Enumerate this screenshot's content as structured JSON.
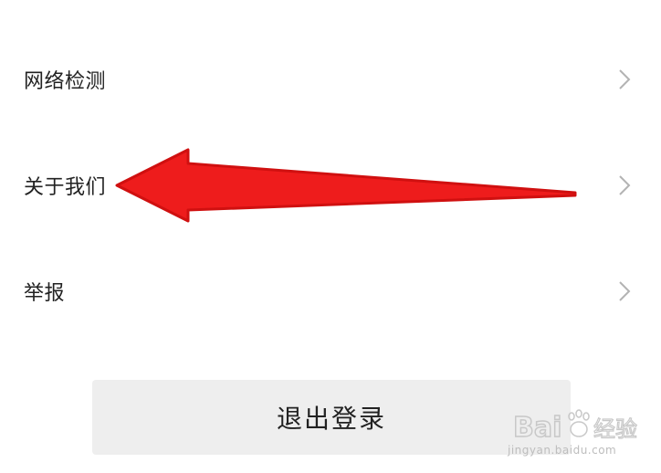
{
  "menu": {
    "items": [
      {
        "label": "网络检测",
        "icon": "chevron-right-icon"
      },
      {
        "label": "关于我们",
        "icon": "chevron-right-icon"
      },
      {
        "label": "举报",
        "icon": "chevron-right-icon"
      }
    ]
  },
  "logout": {
    "label": "退出登录"
  },
  "annotation": {
    "icon": "arrow-left-icon",
    "color": "#ee1c1c"
  },
  "watermark": {
    "logo_text": "Baidu经验",
    "url": "jingyan.baidu.com"
  },
  "colors": {
    "background": "#ffffff",
    "text": "#222222",
    "chevron": "#b3b3b3",
    "button_bg": "#eeeeee",
    "watermark": "#bdbdbd"
  }
}
